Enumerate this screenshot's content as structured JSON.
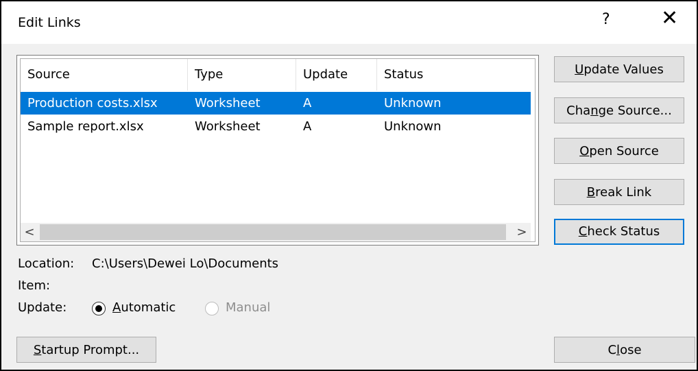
{
  "window": {
    "title": "Edit Links",
    "help": "?",
    "close": "✕"
  },
  "table": {
    "columns": [
      "Source",
      "Type",
      "Update",
      "Status"
    ],
    "rows": [
      {
        "source": "Production costs.xlsx",
        "type": "Worksheet",
        "update": "A",
        "status": "Unknown",
        "selected": true
      },
      {
        "source": "Sample report.xlsx",
        "type": "Worksheet",
        "update": "A",
        "status": "Unknown",
        "selected": false
      }
    ],
    "scroll_left": "<",
    "scroll_right": ">"
  },
  "buttons": {
    "update_values": {
      "pre": "",
      "ul": "U",
      "post": "pdate Values"
    },
    "change_source": {
      "pre": "Cha",
      "ul": "n",
      "post": "ge Source..."
    },
    "open_source": {
      "pre": "",
      "ul": "O",
      "post": "pen Source"
    },
    "break_link": {
      "pre": "",
      "ul": "B",
      "post": "reak Link"
    },
    "check_status": {
      "pre": "",
      "ul": "C",
      "post": "heck Status"
    },
    "startup_prompt": {
      "pre": "",
      "ul": "S",
      "post": "tartup Prompt..."
    },
    "close": {
      "pre": "C",
      "ul": "l",
      "post": "ose"
    }
  },
  "details": {
    "location_label": "Location:",
    "location_value": "C:\\Users\\Dewei Lo\\Documents",
    "item_label": "Item:",
    "update_label": "Update:",
    "automatic": {
      "ul": "A",
      "post": "utomatic"
    },
    "manual": "Manual"
  },
  "colors": {
    "selection": "#0078d7",
    "default_button_border": "#0078d7"
  }
}
